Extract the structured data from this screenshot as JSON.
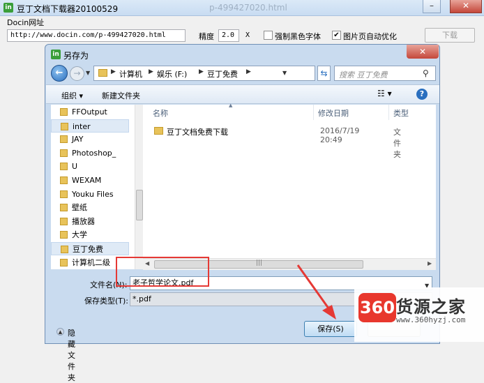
{
  "app": {
    "title": "豆丁文档下载器20100529",
    "bg_url_ghost": "p-499427020.html",
    "docin_label": "Docin网址",
    "url_value": "http://www.docin.com/p-499427020.html",
    "precision_label": "精度",
    "precision_value": "2.0",
    "precision_unit": "X",
    "force_black_label": "强制黑色字体",
    "force_black_checked": false,
    "auto_optimize_label": "图片页自动优化",
    "auto_optimize_checked": true,
    "download_label": "下载"
  },
  "dialog": {
    "title": "另存为",
    "breadcrumb": [
      "计算机",
      "娱乐 (F:)",
      "豆丁免费"
    ],
    "search_placeholder": "搜索 豆丁免费",
    "toolbar": {
      "organize": "组织 ▾",
      "new_folder": "新建文件夹"
    },
    "nav_items": [
      {
        "label": "FFOutput",
        "selected": false
      },
      {
        "label": "inter",
        "selected": true
      },
      {
        "label": "JAY",
        "selected": false
      },
      {
        "label": "Photoshop_",
        "selected": false
      },
      {
        "label": "U",
        "selected": false
      },
      {
        "label": "WEXAM",
        "selected": false
      },
      {
        "label": "Youku Files",
        "selected": false
      },
      {
        "label": "壁纸",
        "selected": false
      },
      {
        "label": "播放器",
        "selected": false
      },
      {
        "label": "大学",
        "selected": false
      },
      {
        "label": "豆丁免费",
        "selected": true
      },
      {
        "label": "计算机二级",
        "selected": false
      }
    ],
    "columns": {
      "name": "名称",
      "date": "修改日期",
      "type": "类型"
    },
    "files": [
      {
        "name": "豆丁文档免费下载",
        "date": "2016/7/19 20:49",
        "type": "文件夹"
      }
    ],
    "filename_label": "文件名(N):",
    "filename_value": "老子哲学论文.pdf",
    "type_label": "保存类型(T):",
    "type_value": "*.pdf",
    "hide_folders": "隐藏文件夹",
    "save_button": "保存(S)"
  },
  "watermark": {
    "badge": "360",
    "name": "货源之家",
    "url": "www.360hyzj.com"
  },
  "colors": {
    "annotation": "#e53935",
    "dialog_bg": "#c9dbef",
    "accent": "#2a6fbf"
  }
}
